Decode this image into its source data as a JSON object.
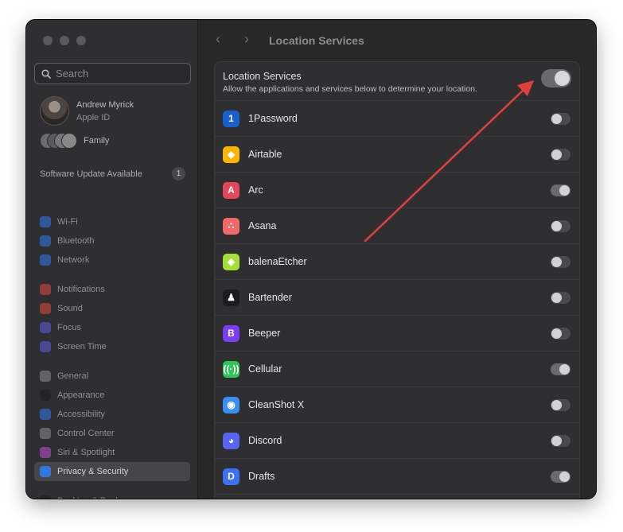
{
  "sidebar": {
    "search_placeholder": "Search",
    "profile": {
      "name": "Andrew Myrick",
      "subtitle": "Apple ID"
    },
    "family_label": "Family",
    "update": {
      "label": "Software Update Available",
      "count": "1"
    },
    "items": [
      {
        "label": "Wi-Fi",
        "icon": "wifi-icon",
        "color": "#2f7cf6"
      },
      {
        "label": "Bluetooth",
        "icon": "bluetooth-icon",
        "color": "#2f7cf6"
      },
      {
        "label": "Network",
        "icon": "globe-icon",
        "color": "#2f7cf6"
      },
      {
        "label": "Notifications",
        "icon": "bell-icon",
        "color": "#e5483f"
      },
      {
        "label": "Sound",
        "icon": "speaker-icon",
        "color": "#e5483f"
      },
      {
        "label": "Focus",
        "icon": "moon-icon",
        "color": "#5e5ce6"
      },
      {
        "label": "Screen Time",
        "icon": "hourglass-icon",
        "color": "#5e5ce6"
      },
      {
        "label": "General",
        "icon": "gear-icon",
        "color": "#8e8e93"
      },
      {
        "label": "Appearance",
        "icon": "appearance-icon",
        "color": "#1c1c1e"
      },
      {
        "label": "Accessibility",
        "icon": "accessibility-icon",
        "color": "#2f7cf6"
      },
      {
        "label": "Control Center",
        "icon": "control-center-icon",
        "color": "#8e8e93"
      },
      {
        "label": "Siri & Spotlight",
        "icon": "siri-icon",
        "color": "#c04fd6"
      },
      {
        "label": "Privacy & Security",
        "icon": "hand-icon",
        "color": "#2f7cf6",
        "selected": true
      },
      {
        "label": "Desktop & Dock",
        "icon": "dock-icon",
        "color": "#1c1c1e"
      }
    ]
  },
  "main": {
    "title": "Location Services",
    "back_label": "‹",
    "forward_label": "›",
    "header": {
      "title": "Location Services",
      "subtitle": "Allow the applications and services below to determine your location.",
      "enabled": true
    },
    "apps": [
      {
        "name": "1Password",
        "icon": "1password-icon",
        "glyph": "1",
        "color": "#1a5fd0",
        "enabled": false
      },
      {
        "name": "Airtable",
        "icon": "airtable-icon",
        "glyph": "◆",
        "color": "#fcb400",
        "enabled": false
      },
      {
        "name": "Arc",
        "icon": "arc-icon",
        "glyph": "A",
        "color": "#e2475b",
        "enabled": true
      },
      {
        "name": "Asana",
        "icon": "asana-icon",
        "glyph": "∴",
        "color": "#f06a6a",
        "enabled": false
      },
      {
        "name": "balenaEtcher",
        "icon": "balenaetcher-icon",
        "glyph": "◈",
        "color": "#a5de37",
        "enabled": false
      },
      {
        "name": "Bartender",
        "icon": "bartender-icon",
        "glyph": "♟",
        "color": "#1c1c1e",
        "enabled": false
      },
      {
        "name": "Beeper",
        "icon": "beeper-icon",
        "glyph": "B",
        "color": "#7b3cf5",
        "enabled": false
      },
      {
        "name": "Cellular",
        "icon": "cellular-icon",
        "glyph": "((·))",
        "color": "#30c559",
        "enabled": true
      },
      {
        "name": "CleanShot X",
        "icon": "cleanshot-icon",
        "glyph": "◉",
        "color": "#3a8ff2",
        "enabled": false
      },
      {
        "name": "Discord",
        "icon": "discord-icon",
        "glyph": "◕",
        "color": "#5865f2",
        "enabled": false
      },
      {
        "name": "Drafts",
        "icon": "drafts-icon",
        "glyph": "D",
        "color": "#3b71f2",
        "enabled": true
      }
    ]
  },
  "annotation": {
    "arrow_color": "#e0403b"
  }
}
